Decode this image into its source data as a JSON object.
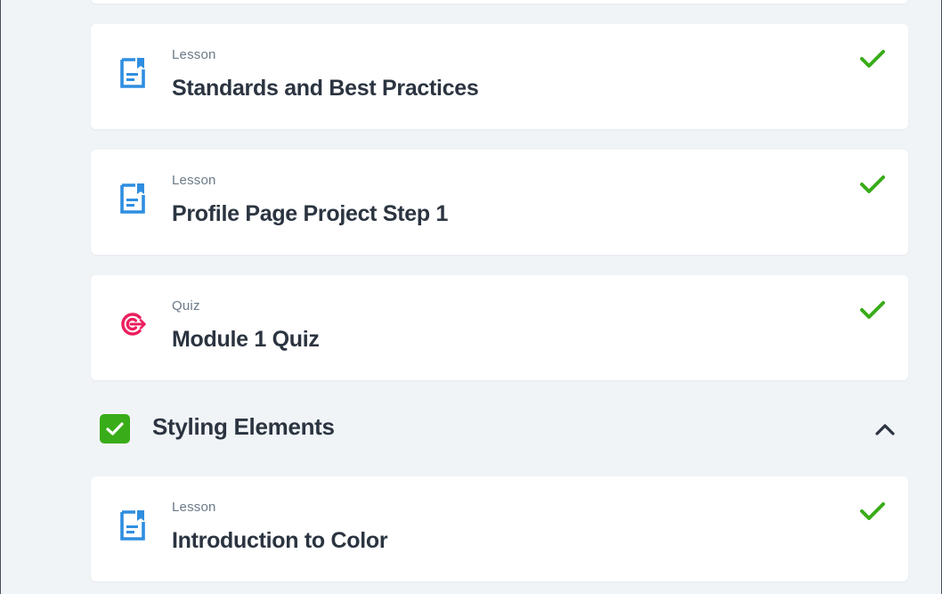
{
  "colors": {
    "lesson_icon": "#2f8ee0",
    "quiz_icon": "#ec1f5e",
    "complete_check": "#39ac19",
    "section_checkbox": "#39ac19",
    "title_text": "#2b3440",
    "type_text": "#6c7a89",
    "page_background": "#f1f4f7"
  },
  "items": [
    {
      "type": "Lesson",
      "title": "Standards and Best Practices",
      "icon": "lesson-document-icon",
      "status": "complete"
    },
    {
      "type": "Lesson",
      "title": "Profile Page Project Step 1",
      "icon": "lesson-document-icon",
      "status": "complete"
    },
    {
      "type": "Quiz",
      "title": "Module 1 Quiz",
      "icon": "target-icon",
      "status": "complete"
    },
    {
      "type": "Lesson",
      "title": "Introduction to Color",
      "icon": "lesson-document-icon",
      "status": "complete"
    }
  ],
  "section": {
    "title": "Styling Elements",
    "checked": true,
    "expanded": true,
    "toggle_icon": "chevron-up-icon"
  }
}
